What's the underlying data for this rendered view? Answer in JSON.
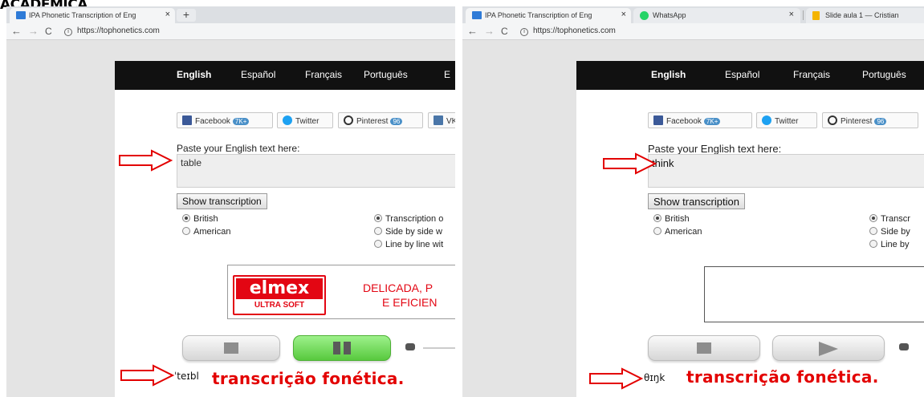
{
  "slide_title": "ACADÊMICA",
  "left": {
    "tabs": [
      {
        "label": "IPA Phonetic Transcription of Eng",
        "close": "×"
      }
    ],
    "new_tab": "+",
    "url": "https://tophonetics.com",
    "nav": {
      "back": "←",
      "forward": "→",
      "reload": "C",
      "info": "i"
    },
    "languages": [
      "English",
      "Español",
      "Français",
      "Português",
      "E"
    ],
    "share": {
      "facebook": "Facebook",
      "facebook_count": "7K+",
      "twitter": "Twitter",
      "pinterest": "Pinterest",
      "pinterest_count": "96",
      "vk": "VK"
    },
    "prompt": "Paste your English text here:",
    "input_text": "table",
    "show_button": "Show transcription",
    "accent": {
      "british": "British",
      "american": "American",
      "selected": "British"
    },
    "display": {
      "opt1": "Transcription o",
      "opt2": "Side by side w",
      "opt3": "Line by line wit",
      "selected": "Transcription o"
    },
    "ad": {
      "brand": "elmex",
      "sub": "ULTRA SOFT",
      "line1": "DELICADA, P",
      "line2": "E EFICIEN"
    },
    "controls_state": "paused",
    "transcription": "ˈteɪbl",
    "caption": "transcrição fonética."
  },
  "right": {
    "tabs": [
      {
        "label": "IPA Phonetic Transcription of Eng",
        "close": "×"
      },
      {
        "label": "WhatsApp",
        "close": "×"
      },
      {
        "label": "Slide aula 1 — Cristian"
      }
    ],
    "url": "https://tophonetics.com",
    "nav": {
      "back": "←",
      "forward": "→",
      "reload": "C",
      "info": "i"
    },
    "languages": [
      "English",
      "Español",
      "Français",
      "Português"
    ],
    "share": {
      "facebook": "Facebook",
      "facebook_count": "7K+",
      "twitter": "Twitter",
      "pinterest": "Pinterest",
      "pinterest_count": "96"
    },
    "prompt": "Paste your English text here:",
    "input_text": "think",
    "show_button": "Show transcription",
    "accent": {
      "british": "British",
      "american": "American",
      "selected": "British"
    },
    "display": {
      "opt1": "Transcr",
      "opt2": "Side by",
      "opt3": "Line by",
      "selected": "Transcr"
    },
    "controls_state": "stopped",
    "transcription": "θɪŋk",
    "caption": "transcrição fonética."
  },
  "colors": {
    "caption_red": "#e30000",
    "arrow_red": "#e30000",
    "nav_black": "#111111",
    "play_green": "#58c93e"
  }
}
